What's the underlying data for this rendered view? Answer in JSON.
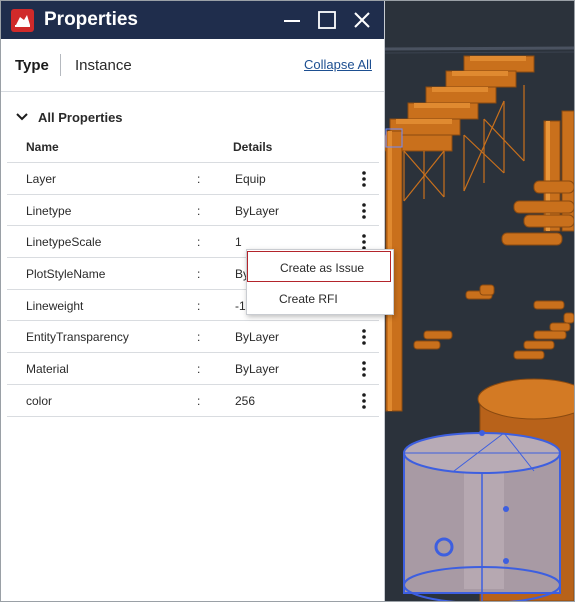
{
  "window": {
    "title": "Properties",
    "accent": "#1f2d4c",
    "logo_color": "#d02a2a"
  },
  "tabs": {
    "type_label": "Type",
    "instance_label": "Instance",
    "collapse_all_label": "Collapse All"
  },
  "section": {
    "label": "All Properties"
  },
  "table": {
    "headers": {
      "name": "Name",
      "details": "Details"
    },
    "rows": [
      {
        "name": "Layer",
        "sep": ":",
        "value": "Equip"
      },
      {
        "name": "Linetype",
        "sep": ":",
        "value": "ByLayer"
      },
      {
        "name": "LinetypeScale",
        "sep": ":",
        "value": "1"
      },
      {
        "name": "PlotStyleName",
        "sep": ":",
        "value": "By"
      },
      {
        "name": "Lineweight",
        "sep": ":",
        "value": "-1"
      },
      {
        "name": "EntityTransparency",
        "sep": ":",
        "value": "ByLayer"
      },
      {
        "name": "Material",
        "sep": ":",
        "value": "ByLayer"
      },
      {
        "name": "color",
        "sep": ":",
        "value": "256"
      }
    ]
  },
  "context_menu": {
    "items": [
      {
        "label": "Create as Issue",
        "highlighted": true
      },
      {
        "label": "Create RFI",
        "highlighted": false
      }
    ],
    "highlight_color": "#b3242b"
  },
  "icons": {
    "logo": "app-logo-icon",
    "minimize": "minimize-icon",
    "maximize": "maximize-icon",
    "close": "close-icon",
    "chevron": "chevron-down-icon",
    "more": "more-vertical-icon"
  },
  "viewport": {
    "background": "#2b323b",
    "model_color": "#c9701c",
    "selection_color": "#3d5fe0"
  }
}
